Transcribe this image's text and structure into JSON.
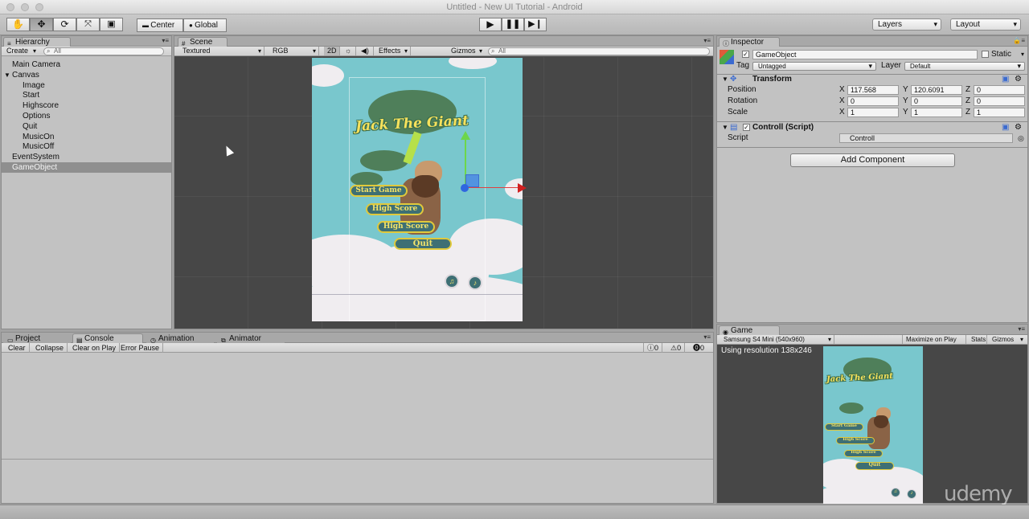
{
  "window": {
    "title": "Untitled - New UI Tutorial - Android"
  },
  "toolbar": {
    "tools": [
      "hand-icon",
      "move-icon",
      "rotate-icon",
      "scale-icon",
      "rect-icon"
    ],
    "pivot": "Center",
    "space": "Global",
    "layers_label": "Layers",
    "layout_label": "Layout"
  },
  "hierarchy": {
    "tab": "Hierarchy",
    "create": "Create",
    "search_placeholder": "All",
    "items": [
      {
        "label": "Main Camera",
        "indent": 0
      },
      {
        "label": "Canvas",
        "indent": 0,
        "expanded": true
      },
      {
        "label": "Image",
        "indent": 1
      },
      {
        "label": "Start",
        "indent": 1
      },
      {
        "label": "Highscore",
        "indent": 1
      },
      {
        "label": "Options",
        "indent": 1
      },
      {
        "label": "Quit",
        "indent": 1
      },
      {
        "label": "MusicOn",
        "indent": 1
      },
      {
        "label": "MusicOff",
        "indent": 1
      },
      {
        "label": "EventSystem",
        "indent": 0
      },
      {
        "label": "GameObject",
        "indent": 0,
        "selected": true
      }
    ]
  },
  "scene": {
    "tab": "Scene",
    "shading": "Textured",
    "render": "RGB",
    "mode2d": "2D",
    "effects": "Effects",
    "gizmos": "Gizmos",
    "search_placeholder": "All"
  },
  "game_art": {
    "title": "Jack The Giant",
    "buttons": [
      "Start Game",
      "High Score",
      "High Score",
      "Quit"
    ]
  },
  "inspector": {
    "tab": "Inspector",
    "object_name": "GameObject",
    "static_label": "Static",
    "tag_label": "Tag",
    "tag_value": "Untagged",
    "layer_label": "Layer",
    "layer_value": "Default",
    "transform": {
      "title": "Transform",
      "position_label": "Position",
      "px": "117.568",
      "py": "120.6091",
      "pz": "0",
      "rotation_label": "Rotation",
      "rx": "0",
      "ry": "0",
      "rz": "0",
      "scale_label": "Scale",
      "sx": "1",
      "sy": "1",
      "sz": "1"
    },
    "script": {
      "title": "Controll (Script)",
      "script_label": "Script",
      "script_value": "Controll"
    },
    "add_component": "Add Component"
  },
  "bottom_tabs": {
    "project": "Project",
    "console": "Console",
    "animation": "Animation",
    "animator": "Animator"
  },
  "console": {
    "clear": "Clear",
    "collapse": "Collapse",
    "clear_on_play": "Clear on Play",
    "error_pause": "Error Pause",
    "log_count": "0",
    "warn_count": "0",
    "error_count": "0"
  },
  "game": {
    "tab": "Game",
    "aspect": "Samsung S4 Mini (540x960)",
    "maximize": "Maximize on Play",
    "stats": "Stats",
    "gizmos": "Gizmos",
    "resolution_text": "Using resolution 138x246"
  },
  "watermark": "udemy"
}
